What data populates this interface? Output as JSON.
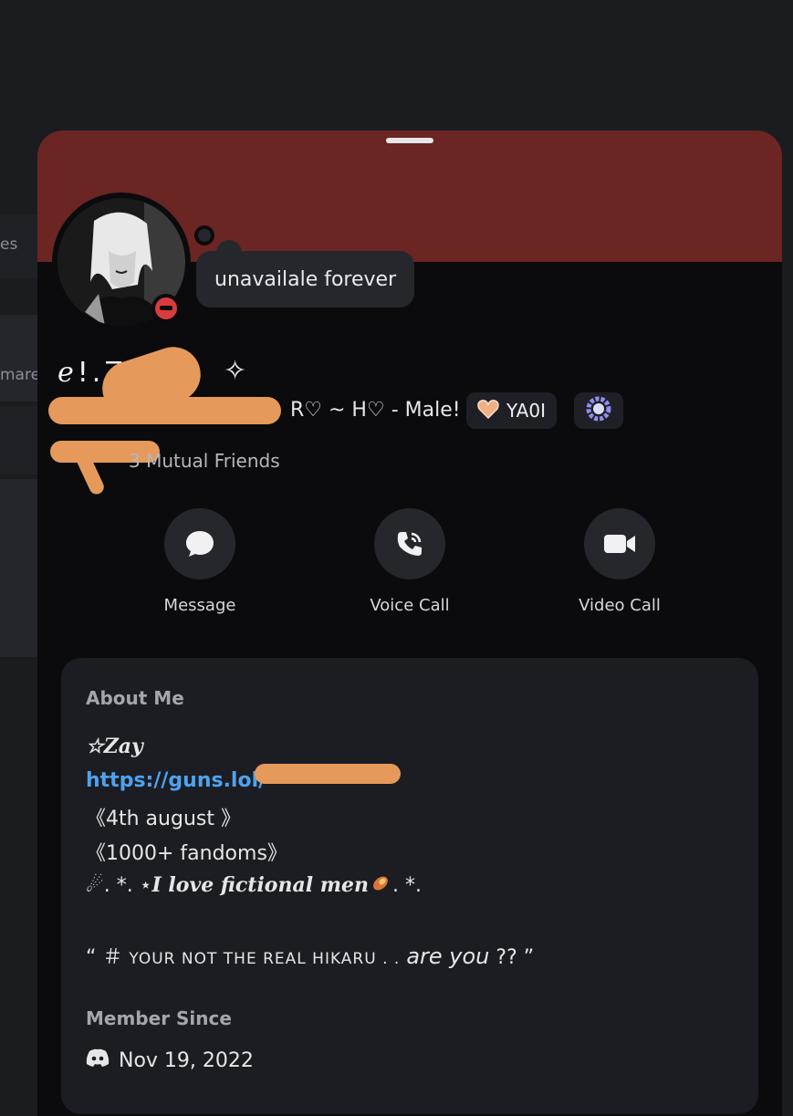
{
  "background_app": {
    "fragment_1": "es",
    "fragment_2": "mare"
  },
  "profile": {
    "status_text": "unavailale forever",
    "name_glyphs": "ℯ!.Z",
    "name_sparkle": "✧",
    "pronouns": "R♡ ~ H♡ - Male!",
    "tags": [
      {
        "icon": "heart-badge-icon",
        "label": "YA0I"
      },
      {
        "icon": "laurel-badge-icon",
        "label": ""
      }
    ],
    "mutual_friends": "3 Mutual Friends",
    "status": "do-not-disturb"
  },
  "actions": [
    {
      "label": "Message",
      "icon": "chat-bubble-icon"
    },
    {
      "label": "Voice Call",
      "icon": "phone-icon"
    },
    {
      "label": "Video Call",
      "icon": "video-camera-icon"
    }
  ],
  "about": {
    "title": "About Me",
    "line_1": "☆Zay",
    "link": "https://guns.lol/",
    "line_3": "《4th august 》",
    "line_4": "《1000+ fandoms》",
    "line_5_prefix": "☄. *. ⋆",
    "line_5_main": "I love fictional men",
    "line_5_suffix": ". *.",
    "quote_open": "“ ＃",
    "quote_caps": "YOUR NOT THE REAL HIKARU . .",
    "quote_italic": "are you",
    "quote_close": "?? ”"
  },
  "member_since": {
    "title": "Member Since",
    "date": "Nov 19, 2022"
  },
  "colors": {
    "banner": "#6b2523",
    "sheet": "#0b0b0d",
    "card": "#1c1d22",
    "link": "#4ea2f0",
    "dnd": "#d83c3e",
    "redaction": "#e59a5b"
  }
}
